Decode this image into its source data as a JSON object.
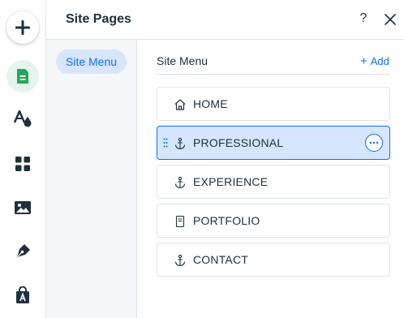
{
  "header": {
    "title": "Site Pages",
    "help_label": "?",
    "close_icon": "close-icon"
  },
  "rail": {
    "items": [
      {
        "icon": "plus-icon",
        "tool": "add"
      },
      {
        "icon": "pages-icon",
        "tool": "pages",
        "active": true
      },
      {
        "icon": "design-icon",
        "tool": "design"
      },
      {
        "icon": "apps-icon",
        "tool": "apps"
      },
      {
        "icon": "media-icon",
        "tool": "media"
      },
      {
        "icon": "blog-pen-icon",
        "tool": "blog"
      },
      {
        "icon": "store-bag-icon",
        "tool": "store"
      }
    ]
  },
  "subnav": {
    "items": [
      {
        "label": "Site Menu",
        "active": true
      }
    ]
  },
  "main": {
    "section_title": "Site Menu",
    "add_label": "Add",
    "add_icon": "plus-icon",
    "pages": [
      {
        "label": "HOME",
        "icon": "home-icon",
        "selected": false
      },
      {
        "label": "PROFESSIONAL",
        "icon": "anchor-icon",
        "selected": true
      },
      {
        "label": "EXPERIENCE",
        "icon": "anchor-icon",
        "selected": false
      },
      {
        "label": "PORTFOLIO",
        "icon": "page-icon",
        "selected": false
      },
      {
        "label": "CONTACT",
        "icon": "anchor-icon",
        "selected": false
      }
    ]
  },
  "colors": {
    "accent": "#116dff",
    "selected_bg": "#d6e6fe",
    "pages_tool_bg": "#e6f5ec",
    "pages_tool_fg": "#25a55a",
    "text": "#20303c",
    "border": "#dfe5eb",
    "subnav_bg": "#f5f7f9"
  }
}
